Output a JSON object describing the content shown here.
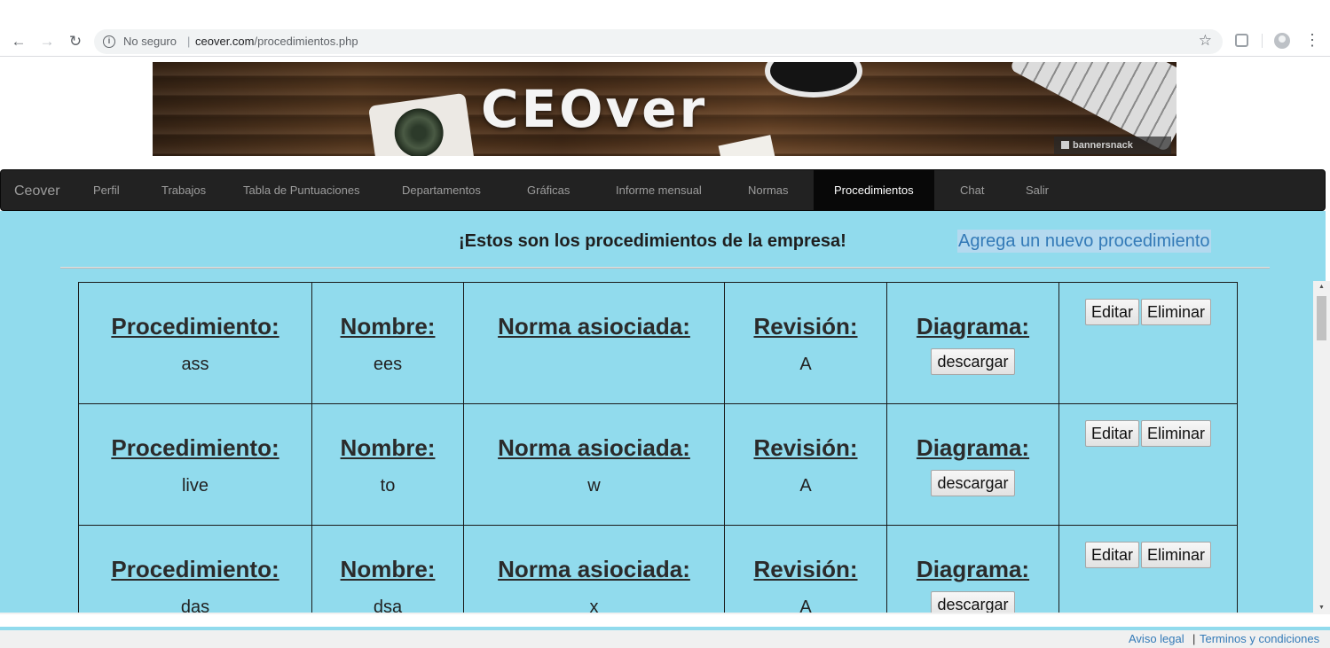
{
  "browser": {
    "security_label": "No seguro",
    "url_domain": "ceover.com",
    "url_path": "/procedimientos.php",
    "icons": [
      "back-icon",
      "forward-icon",
      "reload-icon",
      "info-icon",
      "star-icon",
      "extension-icon",
      "profile-icon",
      "menu-icon"
    ]
  },
  "banner": {
    "logo_text": "CEOver",
    "badge_text": "bannersnack"
  },
  "navbar": {
    "brand": "Ceover",
    "items": [
      {
        "label": "Perfil"
      },
      {
        "label": "Trabajos"
      },
      {
        "label": "Tabla de Puntuaciones"
      },
      {
        "label": "Departamentos"
      },
      {
        "label": "Gráficas"
      },
      {
        "label": "Informe mensual"
      },
      {
        "label": "Normas"
      },
      {
        "label": "Procedimientos",
        "active": true
      },
      {
        "label": "Chat"
      },
      {
        "label": "Salir"
      }
    ]
  },
  "content": {
    "title": "¡Estos son los procedimientos de la empresa!",
    "add_link": "Agrega un nuevo procedimiento",
    "background": "#91dbed"
  },
  "table": {
    "labels": {
      "procedimiento": "Procedimiento:",
      "nombre": "Nombre:",
      "norma": "Norma asiociada:",
      "revision": "Revisión:",
      "diagrama": "Diagrama:"
    },
    "buttons": {
      "descargar": "descargar",
      "editar": "Editar",
      "eliminar": "Eliminar"
    },
    "rows": [
      {
        "procedimiento": "ass",
        "nombre": "ees",
        "norma": "",
        "revision": "A"
      },
      {
        "procedimiento": "live",
        "nombre": "to",
        "norma": "w",
        "revision": "A"
      },
      {
        "procedimiento": "das",
        "nombre": "dsa",
        "norma": "x",
        "revision": "A"
      }
    ]
  },
  "footer": {
    "aviso": "Aviso legal",
    "separator": "|",
    "terminos": "Terminos y condiciones"
  }
}
